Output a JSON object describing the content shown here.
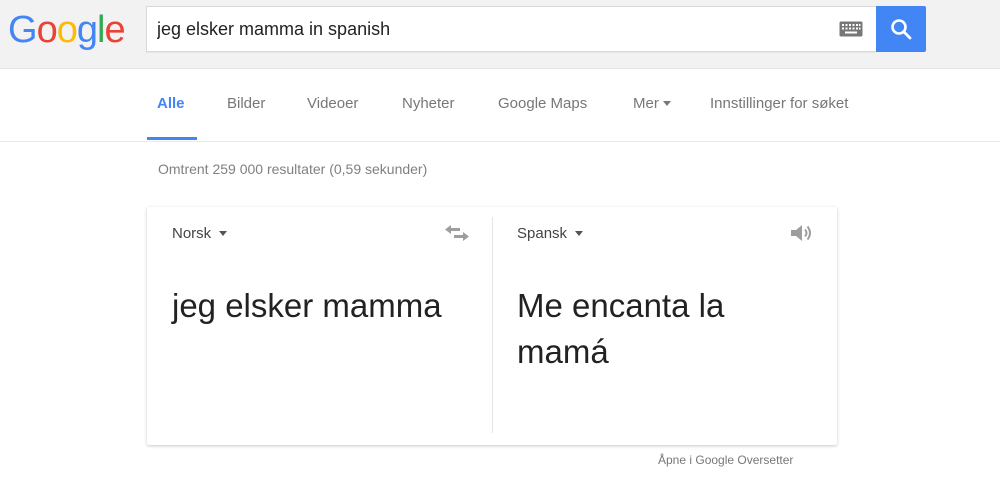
{
  "logo": {
    "letters": [
      "G",
      "o",
      "o",
      "g",
      "l",
      "e"
    ]
  },
  "search": {
    "query": "jeg elsker mamma in spanish"
  },
  "tabs": [
    {
      "label": "Alle"
    },
    {
      "label": "Bilder"
    },
    {
      "label": "Videoer"
    },
    {
      "label": "Nyheter"
    },
    {
      "label": "Google Maps"
    },
    {
      "label": "Mer"
    },
    {
      "label": "Innstillinger for søket"
    }
  ],
  "result_stats": "Omtrent 259 000 resultater (0,59 sekunder)",
  "translate": {
    "source_lang": "Norsk",
    "target_lang": "Spansk",
    "source_text": "jeg elsker mamma",
    "target_text": "Me encanta la mamá",
    "open_link": "Åpne i Google Oversetter"
  },
  "colors": {
    "accent": "#4285f4",
    "header_bg": "#f2f2f2",
    "muted_text": "#777777"
  }
}
